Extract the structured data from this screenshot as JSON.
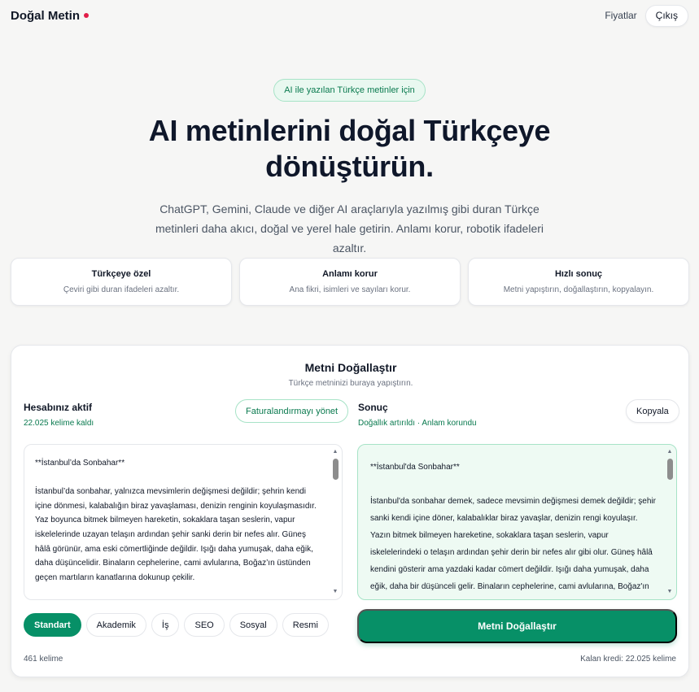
{
  "header": {
    "brand": "Doğal Metin",
    "nav_pricing": "Fiyatlar",
    "nav_logout": "Çıkış"
  },
  "hero": {
    "pill": "AI ile yazılan Türkçe metinler için",
    "title_line1": "AI metinlerini doğal Türkçeye",
    "title_line2": "dönüştürün.",
    "subtitle": "ChatGPT, Gemini, Claude ve diğer AI araçlarıyla yazılmış gibi duran Türkçe metinleri daha akıcı, doğal ve yerel hale getirin. Anlamı korur, robotik ifadeleri azaltır."
  },
  "features": [
    {
      "title": "Türkçeye özel",
      "desc": "Çeviri gibi duran ifadeleri azaltır."
    },
    {
      "title": "Anlamı korur",
      "desc": "Ana fikri, isimleri ve sayıları korur."
    },
    {
      "title": "Hızlı sonuç",
      "desc": "Metni yapıştırın, doğallaştırın, kopyalayın."
    }
  ],
  "panel": {
    "title": "Metni Doğallaştır",
    "subtitle": "Türkçe metninizi buraya yapıştırın.",
    "account_title": "Hesabınız aktif",
    "account_words": "22.025 kelime kaldı",
    "billing_button": "Faturalandırmayı yönet",
    "result_title": "Sonuç",
    "result_meta": "Doğallık artırıldı · Anlam korundu",
    "copy_button": "Kopyala",
    "input_heading": "**İstanbul’da Sonbahar**",
    "input_body": "İstanbul’da sonbahar, yalnızca mevsimlerin değişmesi değildir; şehrin kendi içine dönmesi, kalabalığın biraz yavaşlaması, denizin renginin koyulaşmasıdır. Yaz boyunca bitmek bilmeyen hareketin, sokaklara taşan seslerin, vapur iskelelerinde uzayan telaşın ardından şehir sanki derin bir nefes alır. Güneş hâlâ görünür, ama eski cömertliğinde değildir. Işığı daha yumuşak, daha eğik, daha düşüncelidir. Binaların cephelerine, cami avlularına, Boğaz’ın üstünden geçen martıların kanatlarına dokunup çekilir.",
    "output_heading": "**İstanbul'da Sonbahar**",
    "output_body": "İstanbul'da sonbahar demek, sadece mevsimin değişmesi demek değildir; şehir sanki kendi içine döner, kalabalıklar biraz yavaşlar, denizin rengi koyulaşır. Yazın bitmek bilmeyen hareketine, sokaklara taşan seslerin, vapur iskelelerindeki o telaşın ardından şehir derin bir nefes alır gibi olur. Güneş hâlâ kendini gösterir ama yazdaki kadar cömert değildir. Işığı daha yumuşak, daha eğik, daha bir düşünceli gelir. Binaların cephelerine, cami avlularına, Boğaz'ın üstünden geçen martıların kanatlarına dokunup çekilir.",
    "modes": [
      "Standart",
      "Akademik",
      "İş",
      "SEO",
      "Sosyal",
      "Resmi"
    ],
    "active_mode": "Standart",
    "humanize_button": "Metni Doğallaştır",
    "word_count": "461 kelime",
    "credits": "Kalan kredi: 22.025 kelime"
  },
  "colors": {
    "accent": "#079067",
    "accent_light": "#e9f8f0",
    "brand_dot": "#e11d48"
  }
}
